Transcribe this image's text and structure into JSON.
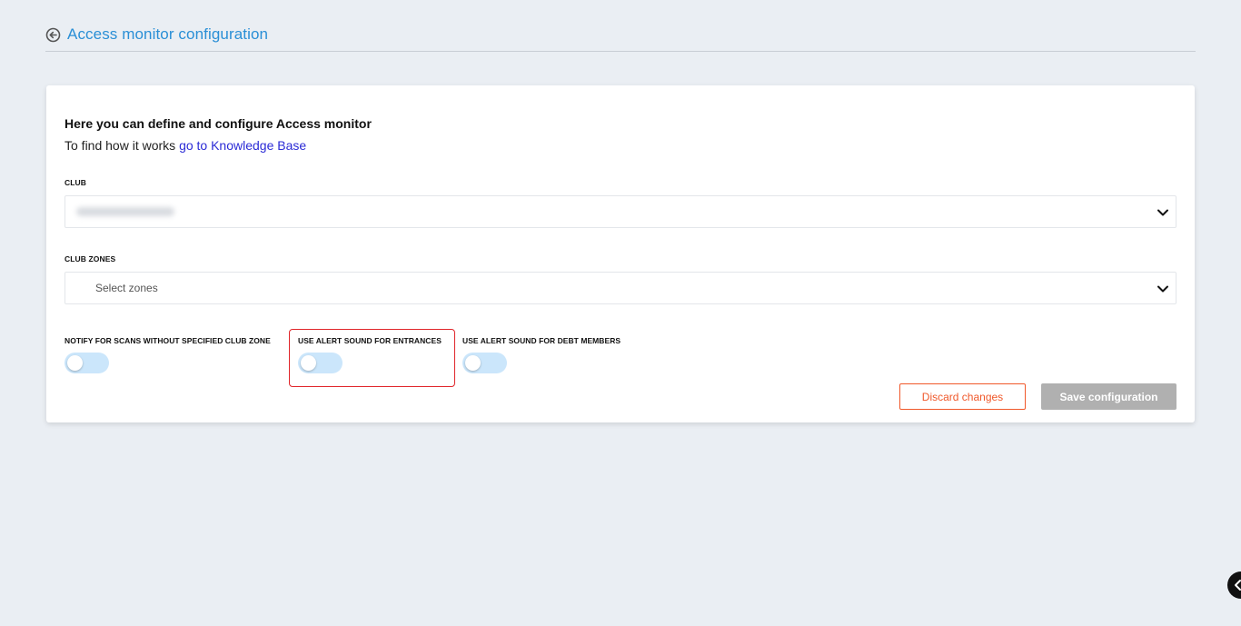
{
  "header": {
    "title": "Access monitor configuration",
    "back_icon": "arrow-circle-left-icon"
  },
  "intro": {
    "title": "Here you can define and configure Access monitor",
    "text_prefix": "To find how it works ",
    "link_text": "go to Knowledge Base"
  },
  "club": {
    "label": "CLUB",
    "value_redacted": true,
    "icon": "chevron-down-icon"
  },
  "zones": {
    "label": "CLUB ZONES",
    "placeholder": "Select zones",
    "icon": "chevron-down-icon"
  },
  "toggles": [
    {
      "label": "NOTIFY FOR SCANS WITHOUT SPECIFIED CLUB ZONE",
      "on": false
    },
    {
      "label": "USE ALERT SOUND FOR ENTRANCES",
      "on": false,
      "highlighted": true
    },
    {
      "label": "USE ALERT SOUND FOR DEBT MEMBERS",
      "on": false
    }
  ],
  "actions": {
    "discard_label": "Discard changes",
    "save_label": "Save configuration"
  },
  "colors": {
    "accent": "#2a8fd6",
    "discard": "#f0582a",
    "save_disabled": "#b0b0b0",
    "toggle_off": "#cbe6fb",
    "highlight": "#e0252a"
  }
}
